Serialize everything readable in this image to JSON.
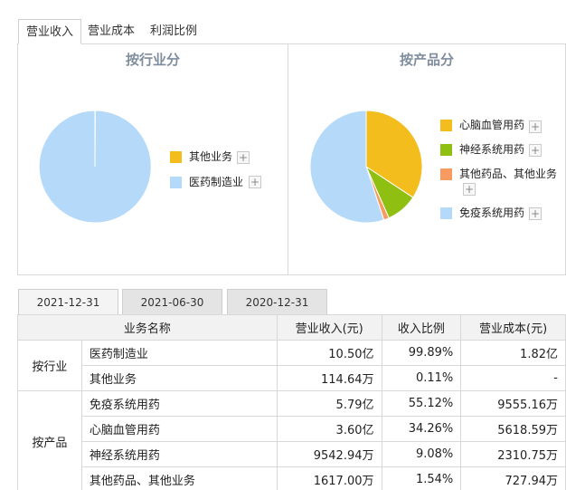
{
  "tabs": [
    "营业收入",
    "营业成本",
    "利润比例"
  ],
  "industry_chart": {
    "title": "按行业分",
    "slices": [
      {
        "name": "其他业务",
        "value": 0.11,
        "color": "#f2bd1d"
      },
      {
        "name": "医药制造业",
        "value": 99.89,
        "color": "#b5d9f9"
      }
    ]
  },
  "product_chart": {
    "title": "按产品分",
    "slices": [
      {
        "name": "心脑血管用药",
        "value": 34.26,
        "color": "#f2bd1d"
      },
      {
        "name": "神经系统用药",
        "value": 9.08,
        "color": "#8fbf10"
      },
      {
        "name": "其他药品、其他业务",
        "value": 1.54,
        "color": "#f79b60"
      },
      {
        "name": "免疫系统用药",
        "value": 55.12,
        "color": "#b5d9f9"
      }
    ]
  },
  "plus_glyph": "+",
  "date_tabs": [
    "2021-12-31",
    "2021-06-30",
    "2020-12-31"
  ],
  "table": {
    "headers": [
      "业务名称",
      "营业收入(元)",
      "收入比例",
      "营业成本(元)"
    ],
    "groups": [
      {
        "name": "按行业",
        "rows": [
          [
            "医药制造业",
            "10.50亿",
            "99.89%",
            "1.82亿"
          ],
          [
            "其他业务",
            "114.64万",
            "0.11%",
            "-"
          ]
        ]
      },
      {
        "name": "按产品",
        "rows": [
          [
            "免疫系统用药",
            "5.79亿",
            "55.12%",
            "9555.16万"
          ],
          [
            "心脑血管用药",
            "3.60亿",
            "34.26%",
            "5618.59万"
          ],
          [
            "神经系统用药",
            "9542.94万",
            "9.08%",
            "2310.75万"
          ],
          [
            "其他药品、其他业务",
            "1617.00万",
            "1.54%",
            "727.94万"
          ]
        ]
      }
    ]
  }
}
